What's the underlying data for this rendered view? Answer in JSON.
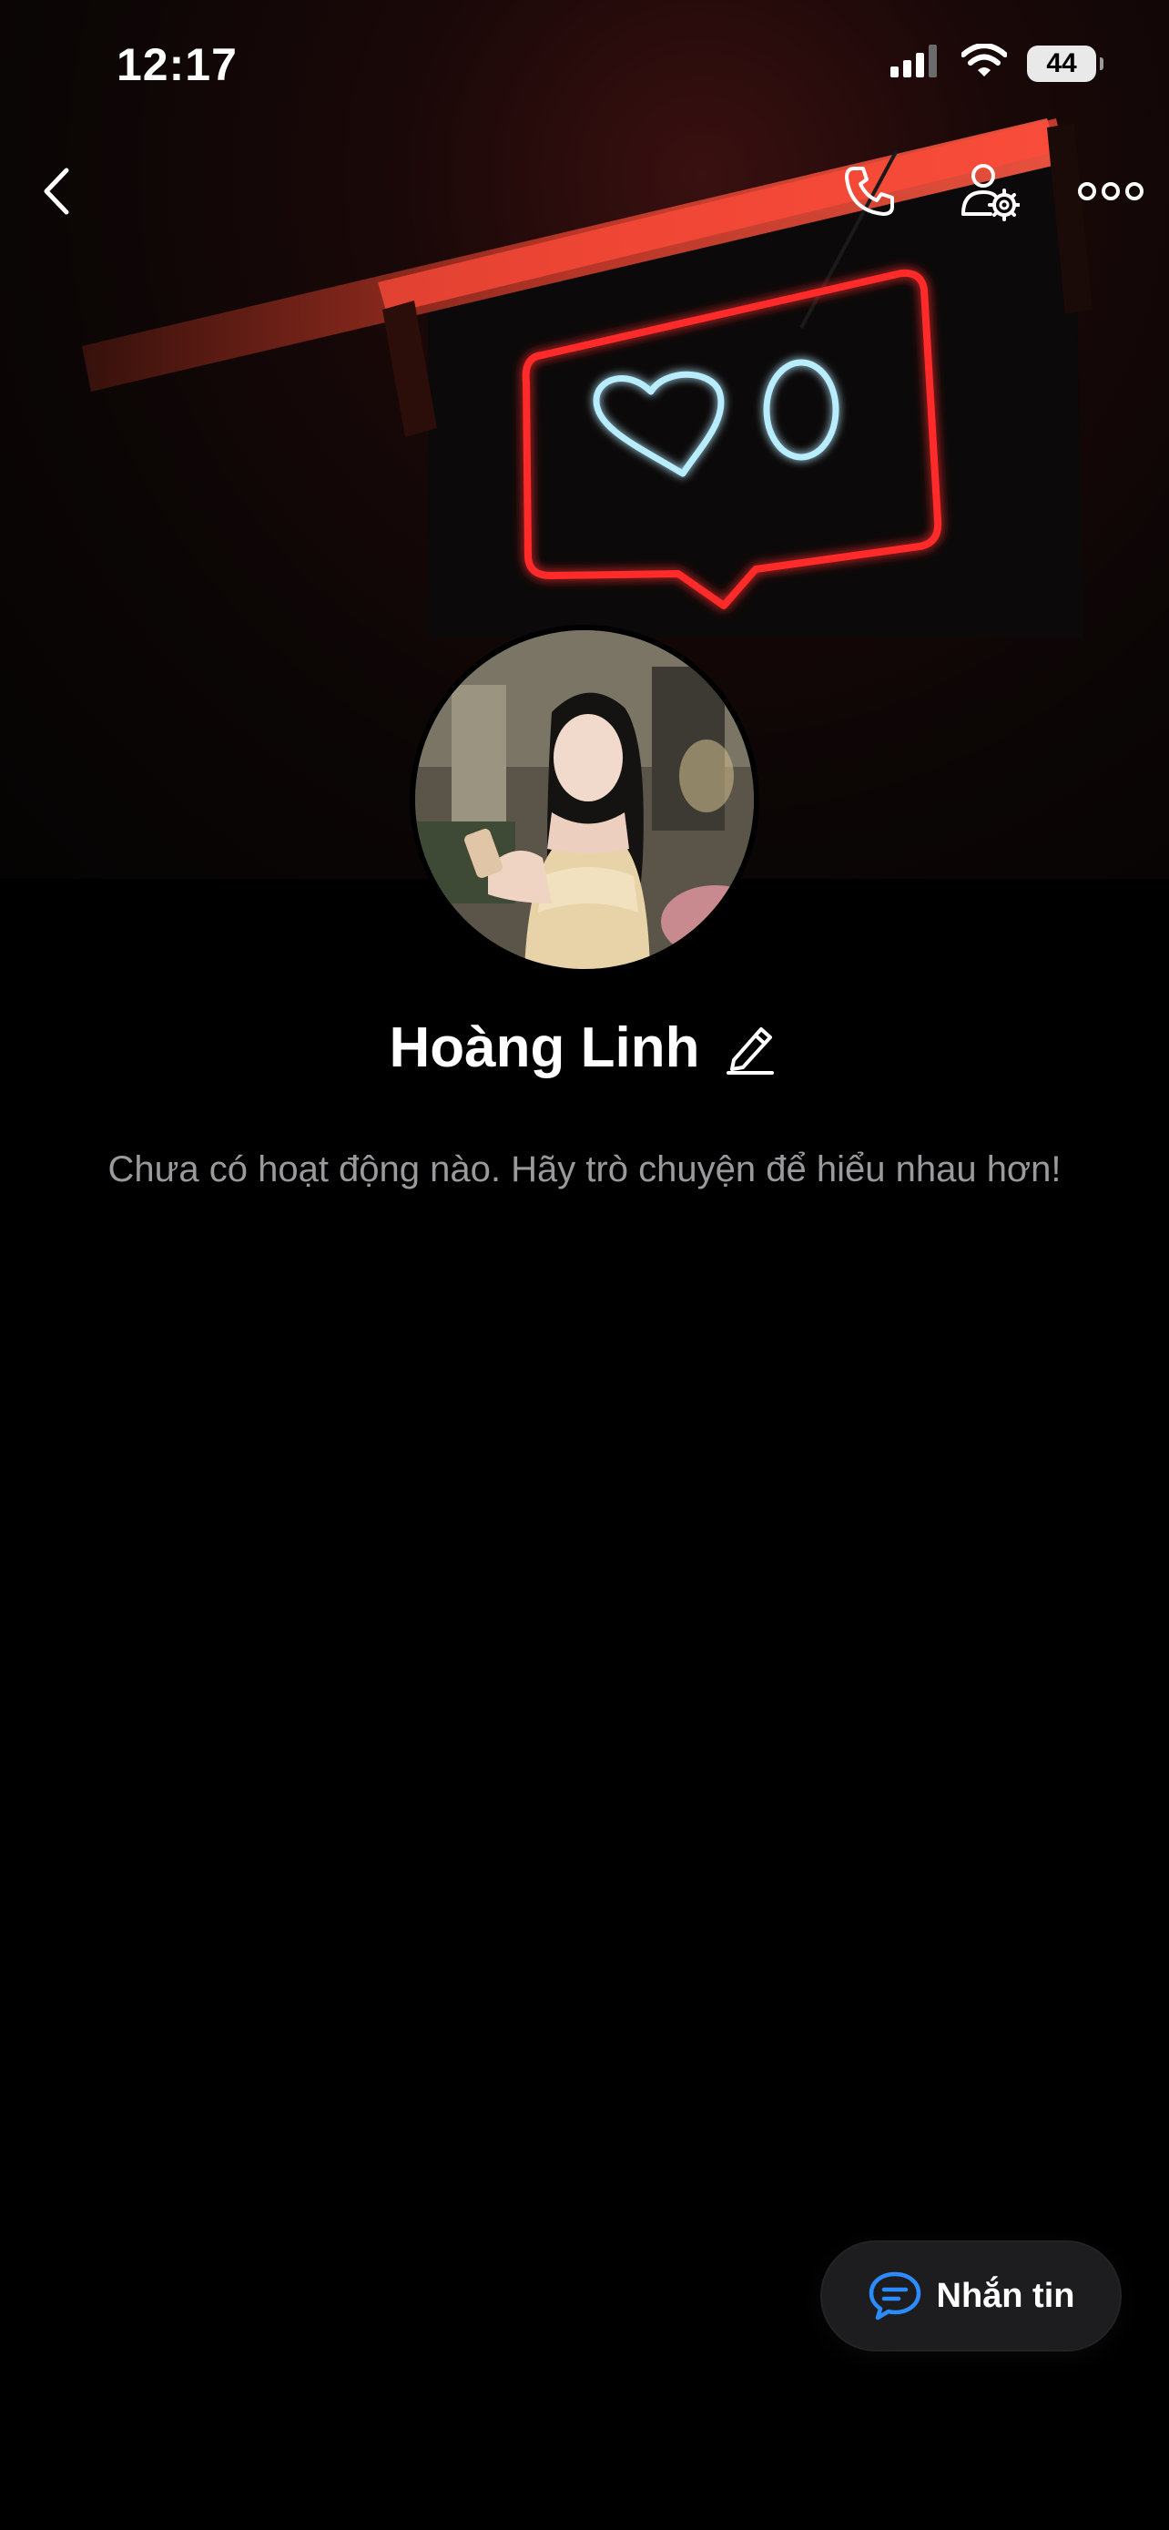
{
  "status_bar": {
    "time": "12:17",
    "battery": "44",
    "icons": [
      "signal-icon",
      "wifi-icon",
      "battery-icon"
    ]
  },
  "top_nav": {
    "icons": [
      "back-icon",
      "phone-icon",
      "user-settings-icon",
      "more-icon"
    ]
  },
  "profile": {
    "name": "Hoàng Linh",
    "empty_message": "Chưa có hoạt động nào. Hãy trò chuyện để hiểu nhau hơn!"
  },
  "message_button": {
    "label": "Nhắn tin",
    "icon": "chat-bubble-icon",
    "accent": "#2b8cff"
  },
  "colors": {
    "background": "#000000",
    "neon_red": "#ff2a2a",
    "neon_blue": "#a8e6ff",
    "secondary_text": "#9a9a9c"
  }
}
